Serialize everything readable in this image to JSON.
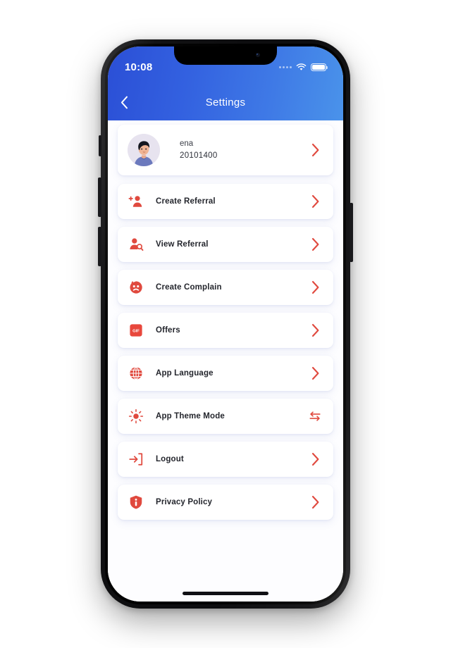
{
  "theme": {
    "accent_red": "#e0493e",
    "header_gradient_start": "#2b4fd6",
    "header_gradient_end": "#4a93ea",
    "screen_bg": "#fdfdff",
    "card_bg": "#ffffff",
    "text_primary": "#24262d"
  },
  "status_bar": {
    "time": "10:08",
    "signal_icon": "signal-dots-icon",
    "wifi_icon": "wifi-icon",
    "battery_icon": "battery-full-icon"
  },
  "header": {
    "title": "Settings",
    "back_icon": "chevron-left-icon"
  },
  "profile": {
    "avatar_icon": "user-avatar-illustration",
    "name": "ena",
    "id": "20101400",
    "trailing_icon": "chevron-right-icon"
  },
  "menu": {
    "items": [
      {
        "label": "Create Referral",
        "icon": "user-plus-icon",
        "trailing_icon": "chevron-right-icon"
      },
      {
        "label": "View Referral",
        "icon": "user-search-icon",
        "trailing_icon": "chevron-right-icon"
      },
      {
        "label": "Create Complain",
        "icon": "complaint-face-icon",
        "trailing_icon": "chevron-right-icon"
      },
      {
        "label": "Offers",
        "icon": "offer-badge-icon",
        "trailing_icon": "chevron-right-icon"
      },
      {
        "label": "App Language",
        "icon": "globe-icon",
        "trailing_icon": "chevron-right-icon"
      },
      {
        "label": "App Theme Mode",
        "icon": "sun-brightness-icon",
        "trailing_icon": "swap-arrows-icon"
      },
      {
        "label": "Logout",
        "icon": "logout-arrow-icon",
        "trailing_icon": "chevron-right-icon"
      },
      {
        "label": "Privacy Policy",
        "icon": "shield-info-icon",
        "trailing_icon": "chevron-right-icon"
      }
    ]
  },
  "system": {
    "home_indicator": "home-indicator-bar"
  }
}
